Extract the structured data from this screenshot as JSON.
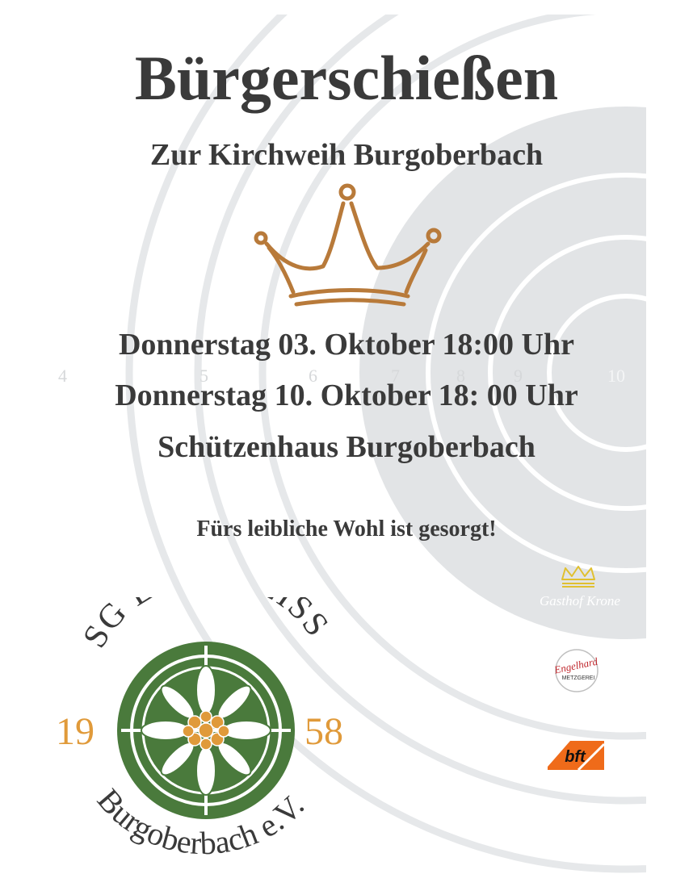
{
  "poster": {
    "title": "Bürgerschießen",
    "subtitle": "Zur Kirchweih Burgoberbach",
    "dates": [
      "Donnerstag 03. Oktober 18:00 Uhr",
      "Donnerstag 10. Oktober 18: 00 Uhr"
    ],
    "venue": "Schützenhaus Burgoberbach",
    "note": "Fürs leibliche Wohl ist gesorgt!"
  },
  "target": {
    "ring_numbers": [
      "4",
      "5",
      "6",
      "7",
      "8",
      "9",
      "10"
    ]
  },
  "club_logo": {
    "name": "SG EDELWEISS",
    "year_left": "19",
    "year_right": "58",
    "place": "Burgoberbach e.V."
  },
  "sponsors": {
    "gasthof": "Gasthof Krone",
    "metzgerei": "Engelhard",
    "metzgerei_sub": "METZGEREI",
    "bft": "bft"
  },
  "colors": {
    "text": "#3a3a3a",
    "crown": "#b87a3a",
    "logo_green": "#4a7a3c",
    "logo_orange": "#e09a3a",
    "target_gray": "#e2e4e6",
    "bft_orange": "#ef6b1a"
  }
}
